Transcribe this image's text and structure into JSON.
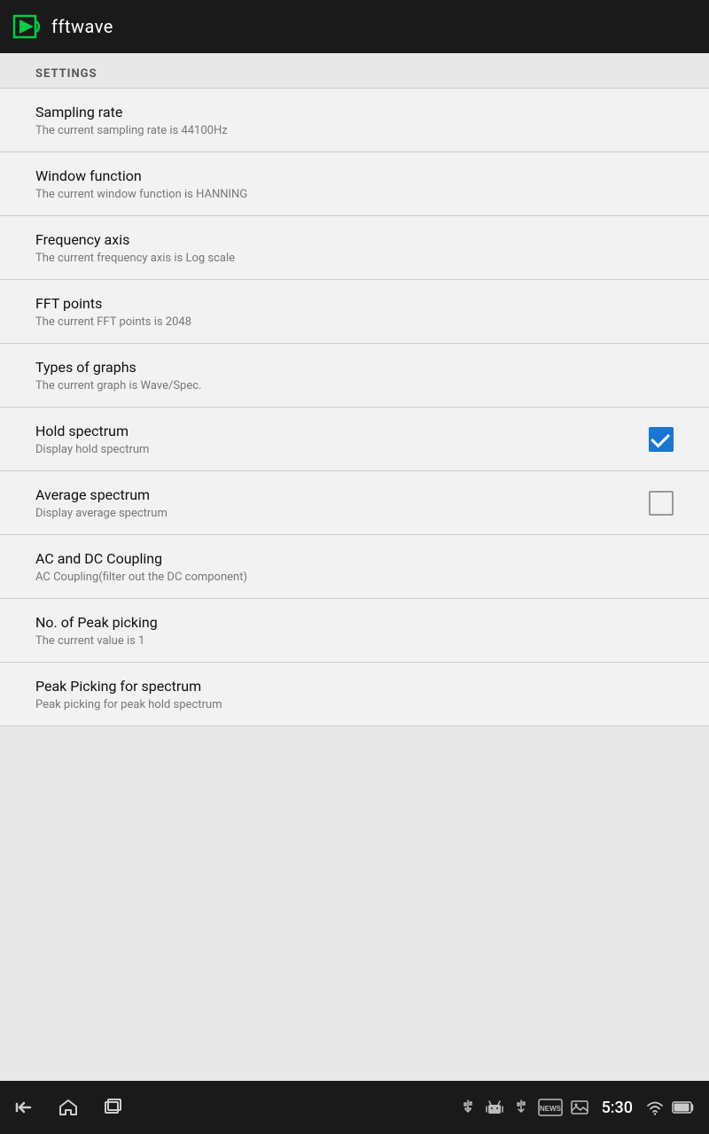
{
  "app": {
    "title": "fftwave"
  },
  "topbar": {
    "title": "fftwave"
  },
  "settings": {
    "section_label": "SETTINGS",
    "items": [
      {
        "id": "sampling-rate",
        "title": "Sampling rate",
        "subtitle": "The current sampling rate is 44100Hz",
        "has_checkbox": false,
        "checked": null
      },
      {
        "id": "window-function",
        "title": "Window function",
        "subtitle": "The current window function is HANNING",
        "has_checkbox": false,
        "checked": null
      },
      {
        "id": "frequency-axis",
        "title": "Frequency axis",
        "subtitle": "The current frequency axis is Log scale",
        "has_checkbox": false,
        "checked": null
      },
      {
        "id": "fft-points",
        "title": "FFT points",
        "subtitle": "The current FFT points is 2048",
        "has_checkbox": false,
        "checked": null
      },
      {
        "id": "types-of-graphs",
        "title": "Types of graphs",
        "subtitle": "The current graph is Wave/Spec.",
        "has_checkbox": false,
        "checked": null
      },
      {
        "id": "hold-spectrum",
        "title": "Hold spectrum",
        "subtitle": "Display hold spectrum",
        "has_checkbox": true,
        "checked": true
      },
      {
        "id": "average-spectrum",
        "title": "Average spectrum",
        "subtitle": "Display average spectrum",
        "has_checkbox": true,
        "checked": false
      },
      {
        "id": "ac-dc-coupling",
        "title": "AC and DC Coupling",
        "subtitle": "AC Coupling(filter out the DC component)",
        "has_checkbox": false,
        "checked": null
      },
      {
        "id": "no-peak-picking",
        "title": "No. of Peak picking",
        "subtitle": "The current value is 1",
        "has_checkbox": false,
        "checked": null
      },
      {
        "id": "peak-picking-spectrum",
        "title": "Peak Picking for spectrum",
        "subtitle": "Peak picking for peak hold spectrum",
        "has_checkbox": false,
        "checked": null
      }
    ]
  },
  "bottombar": {
    "time": "5:30",
    "nav_back_label": "back",
    "nav_home_label": "home",
    "nav_recents_label": "recents"
  }
}
